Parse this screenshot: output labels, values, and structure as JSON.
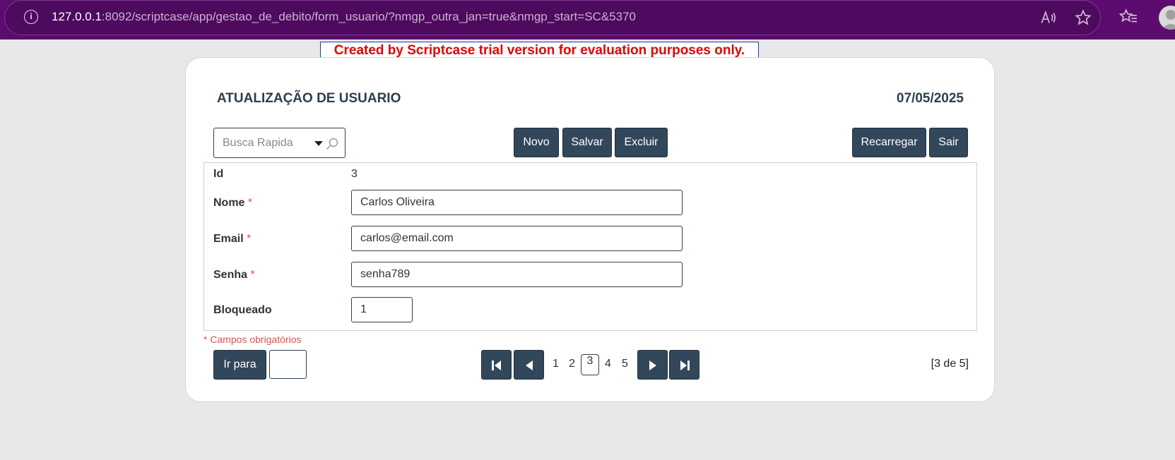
{
  "browser": {
    "url_host": "127.0.0.1",
    "url_rest": ":8092/scriptcase/app/gestao_de_debito/form_usuario/?nmgp_outra_jan=true&nmgp_start=SC&5370",
    "info_icon": "i"
  },
  "trial_banner": "Created by Scriptcase trial version for evaluation purposes only.",
  "header": {
    "title": "ATUALIZAÇÃO DE USUARIO",
    "date": "07/05/2025"
  },
  "toolbar": {
    "search_placeholder": "Busca Rapida",
    "novo": "Novo",
    "salvar": "Salvar",
    "excluir": "Excluir",
    "recarregar": "Recarregar",
    "sair": "Sair"
  },
  "form": {
    "id_label": "Id",
    "id_value": "3",
    "nome_label": "Nome",
    "nome_value": "Carlos Oliveira",
    "email_label": "Email",
    "email_value": "carlos@email.com",
    "senha_label": "Senha",
    "senha_value": "senha789",
    "bloqueado_label": "Bloqueado",
    "bloqueado_value": "1",
    "required_marker": "*"
  },
  "required_note": "* Campos obrigatórios",
  "pagination": {
    "goto_label": "Ir para",
    "pages": [
      "1",
      "2",
      "3",
      "4",
      "5"
    ],
    "current_page": "3",
    "record_count": "[3 de 5]"
  },
  "colors": {
    "browser_bar": "#5b0c6e",
    "button": "#33475b",
    "required": "#d9534f",
    "banner_text": "#e60000"
  }
}
